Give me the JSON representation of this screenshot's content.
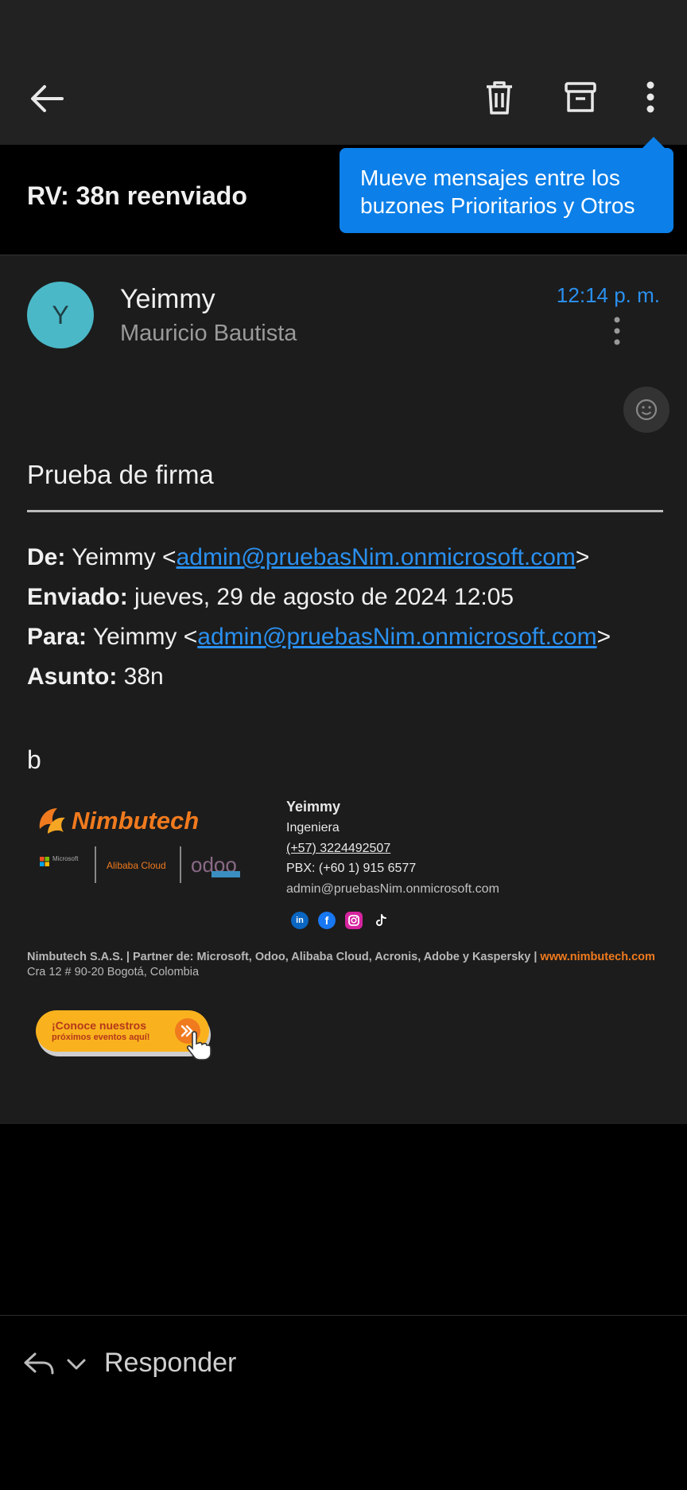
{
  "app": {
    "subject": "RV: 38n reenviado",
    "tooltip": "Mueve mensajes entre los buzones Prioritarios y Otros",
    "icons": [
      "back-arrow-icon",
      "trash-icon",
      "archive-icon",
      "more-vert-icon"
    ]
  },
  "message": {
    "avatar_letter": "Y",
    "sender": "Yeimmy",
    "recipient": "Mauricio Bautista",
    "time": "12:14 p. m.",
    "accent_color": "#2a90f0",
    "avatar_color": "#4ab8c7"
  },
  "body": {
    "title": "Prueba de firma",
    "from_label": "De:",
    "from_name": "Yeimmy <",
    "from_email": "admin@pruebasNim.onmicrosoft.com",
    "from_close": ">",
    "sent_label": "Enviado:",
    "sent_value": "jueves, 29 de agosto de 2024 12:05",
    "to_label": "Para:",
    "to_name": "Yeimmy <",
    "to_email": "admin@pruebasNim.onmicrosoft.com",
    "to_close": ">",
    "subject_label": "Asunto:",
    "subject_value": "38n",
    "text": "b"
  },
  "signature": {
    "logo_text": "Nimbutech",
    "partner_logos": [
      "Microsoft",
      "Alibaba Cloud",
      "odoo"
    ],
    "name": "Yeimmy",
    "role": "Ingeniera",
    "phone": "(+57) 3224492507",
    "pbx": "PBX: (+60 1) 915 6577",
    "email": "admin@pruebasNim.onmicrosoft.com",
    "social": [
      "linkedin-icon",
      "facebook-icon",
      "instagram-icon",
      "tiktok-icon"
    ],
    "footer_company": "Nimbutech S.A.S. | Partner de: Microsoft, Odoo, Alibaba Cloud, Acronis, Adobe y Kaspersky | ",
    "footer_web": "www.nimbutech.com",
    "footer_address": "Cra 12 # 90-20 Bogotá, Colombia",
    "banner_line1": "¡Conoce nuestros",
    "banner_line2": "próximos eventos aquí!",
    "brand_color": "#f07a1e"
  },
  "footer": {
    "reply_label": "Responder"
  }
}
